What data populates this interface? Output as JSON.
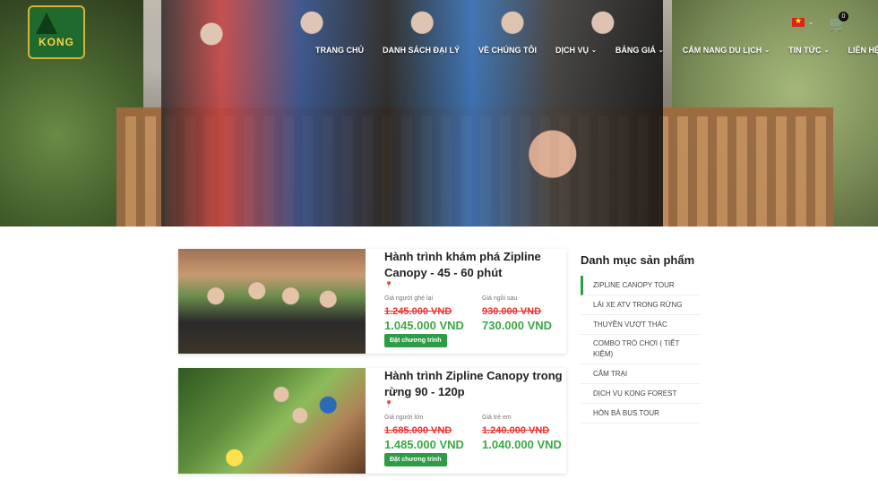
{
  "header": {
    "logo_text": "KONG",
    "logo_sub": "",
    "nav": [
      {
        "label": "TRANG CHỦ",
        "dropdown": false
      },
      {
        "label": "DANH SÁCH ĐẠI LÝ",
        "dropdown": false
      },
      {
        "label": "VỀ CHÚNG TÔI",
        "dropdown": false
      },
      {
        "label": "DỊCH VỤ",
        "dropdown": true
      },
      {
        "label": "BẢNG GIÁ",
        "dropdown": true
      },
      {
        "label": "CẨM NANG DU LỊCH",
        "dropdown": true
      },
      {
        "label": "TIN TỨC",
        "dropdown": true
      },
      {
        "label": "LIÊN HỆ",
        "dropdown": false
      }
    ],
    "cart_count": "0"
  },
  "products": [
    {
      "title": "Hành trình khám phá Zipline Canopy - 45 - 60 phút",
      "label1": "Giá người ghé lại",
      "old1": "1.245.000 VND",
      "new1": "1.045.000 VND",
      "label2": "Giá ngồi sau",
      "old2": "930.000 VND",
      "new2": "730.000 VND",
      "button": "Đặt chương trình"
    },
    {
      "title": "Hành trình Zipline Canopy trong rừng 90 - 120p",
      "label1": "Giá người lớn",
      "old1": "1.685.000 VND",
      "new1": "1.485.000 VND",
      "label2": "Giá trẻ em",
      "old2": "1.240.000 VND",
      "new2": "1.040.000 VND",
      "button": "Đặt chương trình"
    }
  ],
  "sidebar": {
    "title": "Danh mục sản phẩm",
    "items": [
      "ZIPLINE CANOPY TOUR",
      "LÁI XE ATV TRONG RỪNG",
      "THUYỀN VƯỢT THÁC",
      "COMBO TRÒ CHƠI ( TIẾT KIỆM)",
      "CẮM TRẠI",
      "DỊCH VỤ KONG FOREST",
      "HÒN BÀ BUS TOUR"
    ]
  }
}
